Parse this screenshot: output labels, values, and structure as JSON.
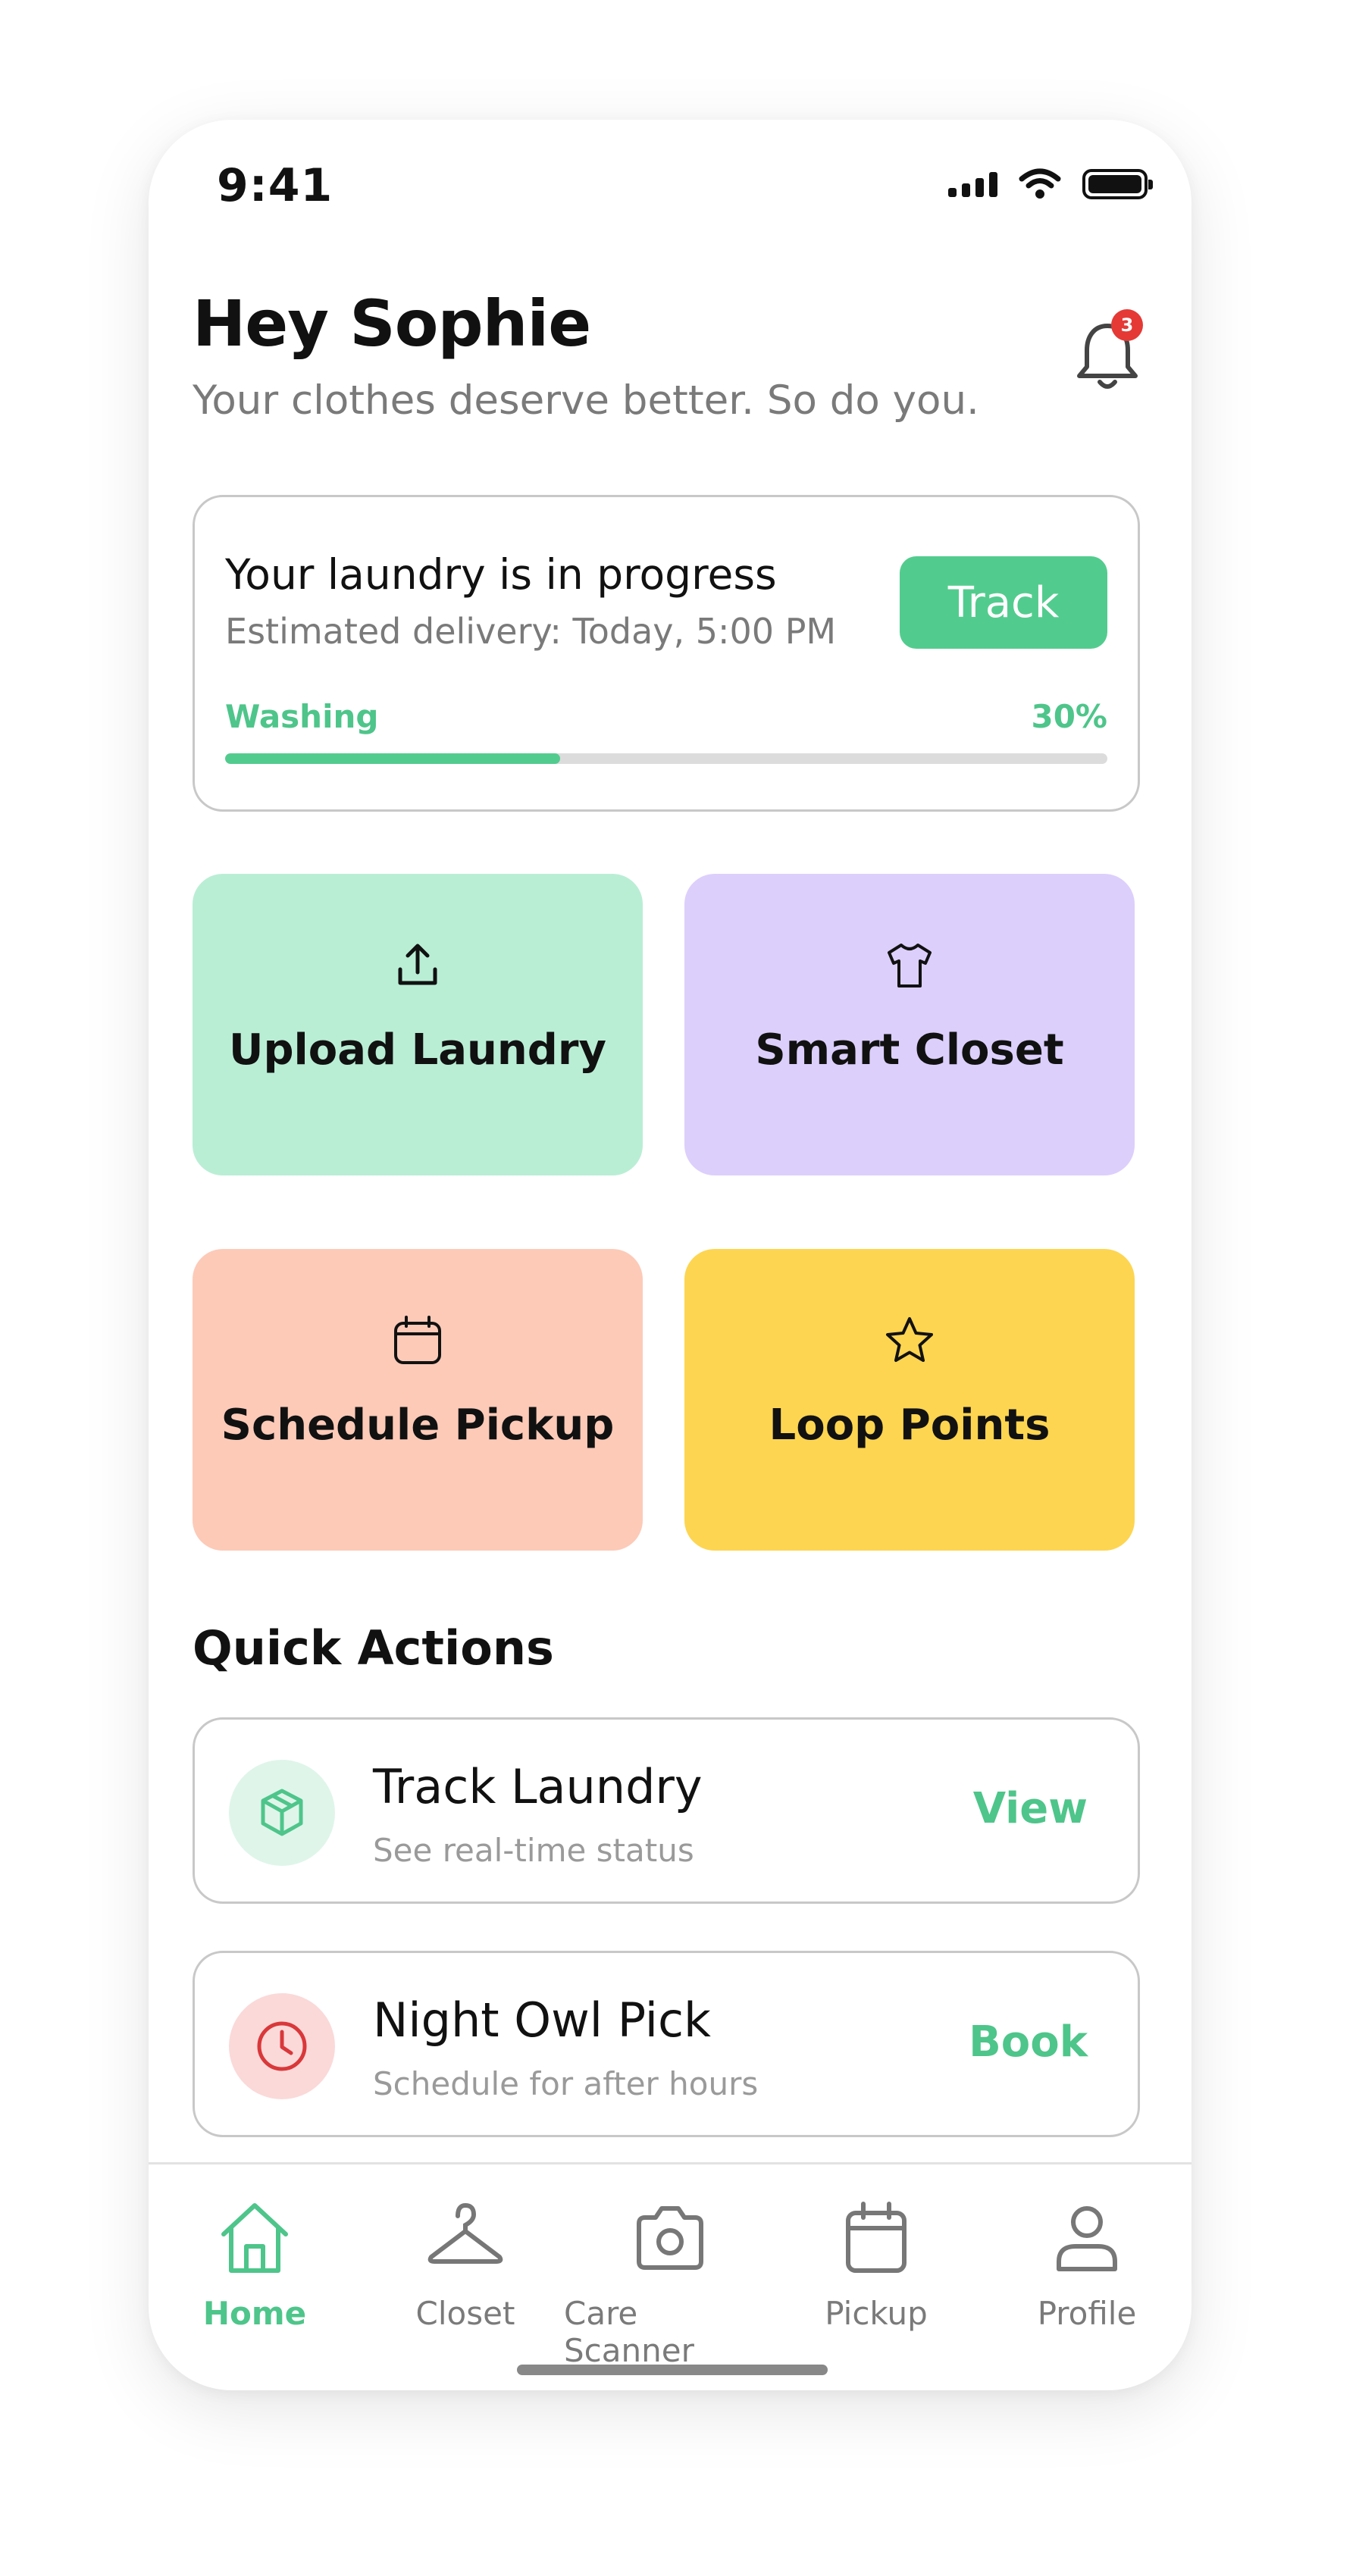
{
  "status_bar": {
    "time": "9:41"
  },
  "header": {
    "greeting": "Hey Sophie",
    "tagline": "Your clothes deserve better. So do you.",
    "notification_count": "3"
  },
  "progress_card": {
    "title": "Your laundry is in progress",
    "subtitle": "Estimated delivery: Today, 5:00 PM",
    "button_label": "Track",
    "stage": "Washing",
    "percent_label": "30%",
    "progress_fraction": 0.38
  },
  "tiles": [
    {
      "label": "Upload Laundry",
      "icon": "upload-icon",
      "color": "#b9eed5"
    },
    {
      "label": "Smart Closet",
      "icon": "shirt-icon",
      "color": "#dccffc"
    },
    {
      "label": "Schedule Pickup",
      "icon": "calendar-icon",
      "color": "#fdcab8"
    },
    {
      "label": "Loop Points",
      "icon": "star-icon",
      "color": "#fdd550"
    }
  ],
  "quick_actions": {
    "title": "Quick Actions",
    "items": [
      {
        "name": "Track Laundry",
        "desc": "See real-time status",
        "action": "View",
        "icon": "package-icon"
      },
      {
        "name": "Night Owl Pick",
        "desc": "Schedule for after hours",
        "action": "Book",
        "icon": "clock-icon"
      }
    ]
  },
  "nav": {
    "items": [
      {
        "label": "Home",
        "icon": "home-icon",
        "active": true
      },
      {
        "label": "Closet",
        "icon": "hanger-icon",
        "active": false
      },
      {
        "label": "Care Scanner",
        "icon": "camera-icon",
        "active": false
      },
      {
        "label": "Pickup",
        "icon": "calendar-icon",
        "active": false
      },
      {
        "label": "Profile",
        "icon": "user-icon",
        "active": false
      }
    ]
  },
  "colors": {
    "accent": "#52cc8e",
    "accent_text": "#4ec58a",
    "badge": "#e53935",
    "muted_text": "#7a7a7a"
  }
}
